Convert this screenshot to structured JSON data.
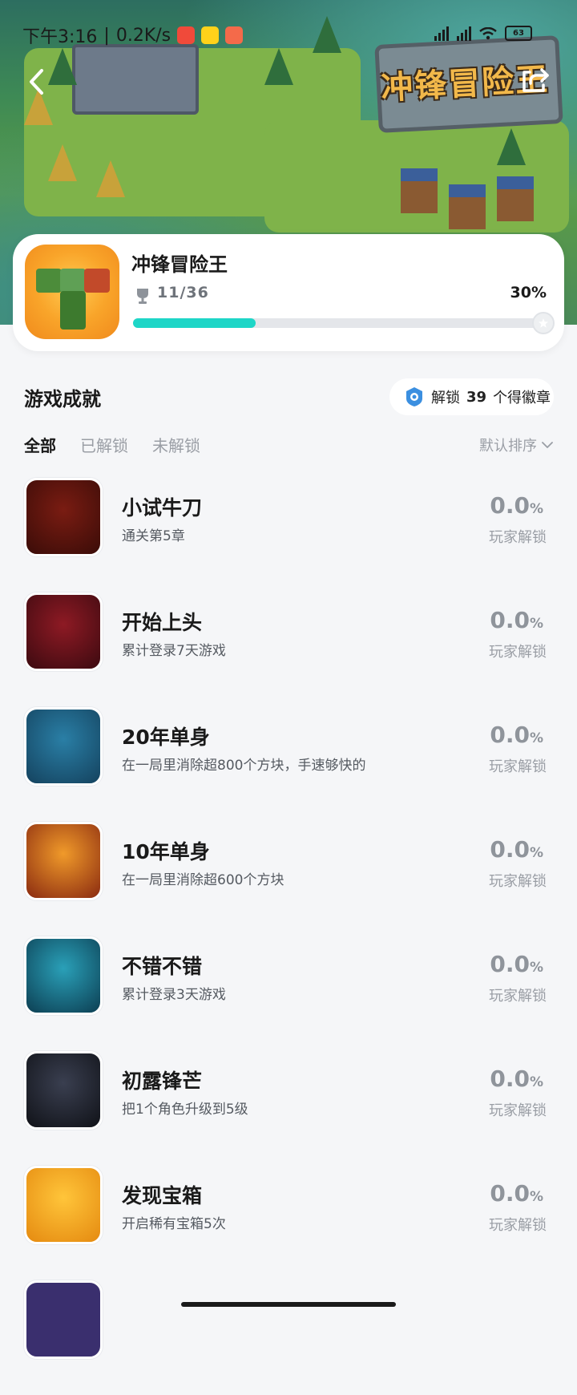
{
  "status_bar": {
    "time": "下午3:16",
    "speed": "0.2K/s",
    "battery": "63"
  },
  "banner": {
    "logo_text": "冲锋冒险王"
  },
  "game": {
    "title": "冲锋冒险王",
    "achievement_count": "11/36",
    "progress_percent": "30%",
    "progress_fraction": 0.3
  },
  "section": {
    "title": "游戏成就",
    "badge_prefix": "解锁",
    "badge_count": "39",
    "badge_suffix": "个得徽章"
  },
  "tabs": [
    {
      "label": "全部",
      "active": true
    },
    {
      "label": "已解锁",
      "active": false
    },
    {
      "label": "未解锁",
      "active": false
    }
  ],
  "sort_label": "默认排序",
  "achievements": [
    {
      "name": "小试牛刀",
      "desc": "通关第5章",
      "rate": "0.0",
      "unit": "%",
      "sub": "玩家解锁",
      "icon": "sword-hero-icon",
      "colors": [
        "#7a1c12",
        "#3a0c08"
      ]
    },
    {
      "name": "开始上头",
      "desc": "累计登录7天游戏",
      "rate": "0.0",
      "unit": "%",
      "sub": "玩家解锁",
      "icon": "hooded-figure-icon",
      "colors": [
        "#8e1a24",
        "#3c0a10"
      ]
    },
    {
      "name": "20年单身",
      "desc": "在一局里消除超800个方块，手速够快的",
      "rate": "0.0",
      "unit": "%",
      "sub": "玩家解锁",
      "icon": "two-characters-icon",
      "colors": [
        "#2a7fa6",
        "#14425e"
      ]
    },
    {
      "name": "10年单身",
      "desc": "在一局里消除超600个方块",
      "rate": "0.0",
      "unit": "%",
      "sub": "玩家解锁",
      "icon": "fire-crowd-icon",
      "colors": [
        "#f09a2a",
        "#8a2a10"
      ]
    },
    {
      "name": "不错不错",
      "desc": "累计登录3天游戏",
      "rate": "0.0",
      "unit": "%",
      "sub": "玩家解锁",
      "icon": "glowing-orb-icon",
      "colors": [
        "#2aa0b8",
        "#0c3e52"
      ]
    },
    {
      "name": "初露锋芒",
      "desc": "把1个角色升级到5级",
      "rate": "0.0",
      "unit": "%",
      "sub": "玩家解锁",
      "icon": "ghost-character-icon",
      "colors": [
        "#3a3f50",
        "#101218"
      ]
    },
    {
      "name": "发现宝箱",
      "desc": "开启稀有宝箱5次",
      "rate": "0.0",
      "unit": "%",
      "sub": "玩家解锁",
      "icon": "music-note-icon",
      "colors": [
        "#ffc53a",
        "#e58a10"
      ]
    }
  ]
}
